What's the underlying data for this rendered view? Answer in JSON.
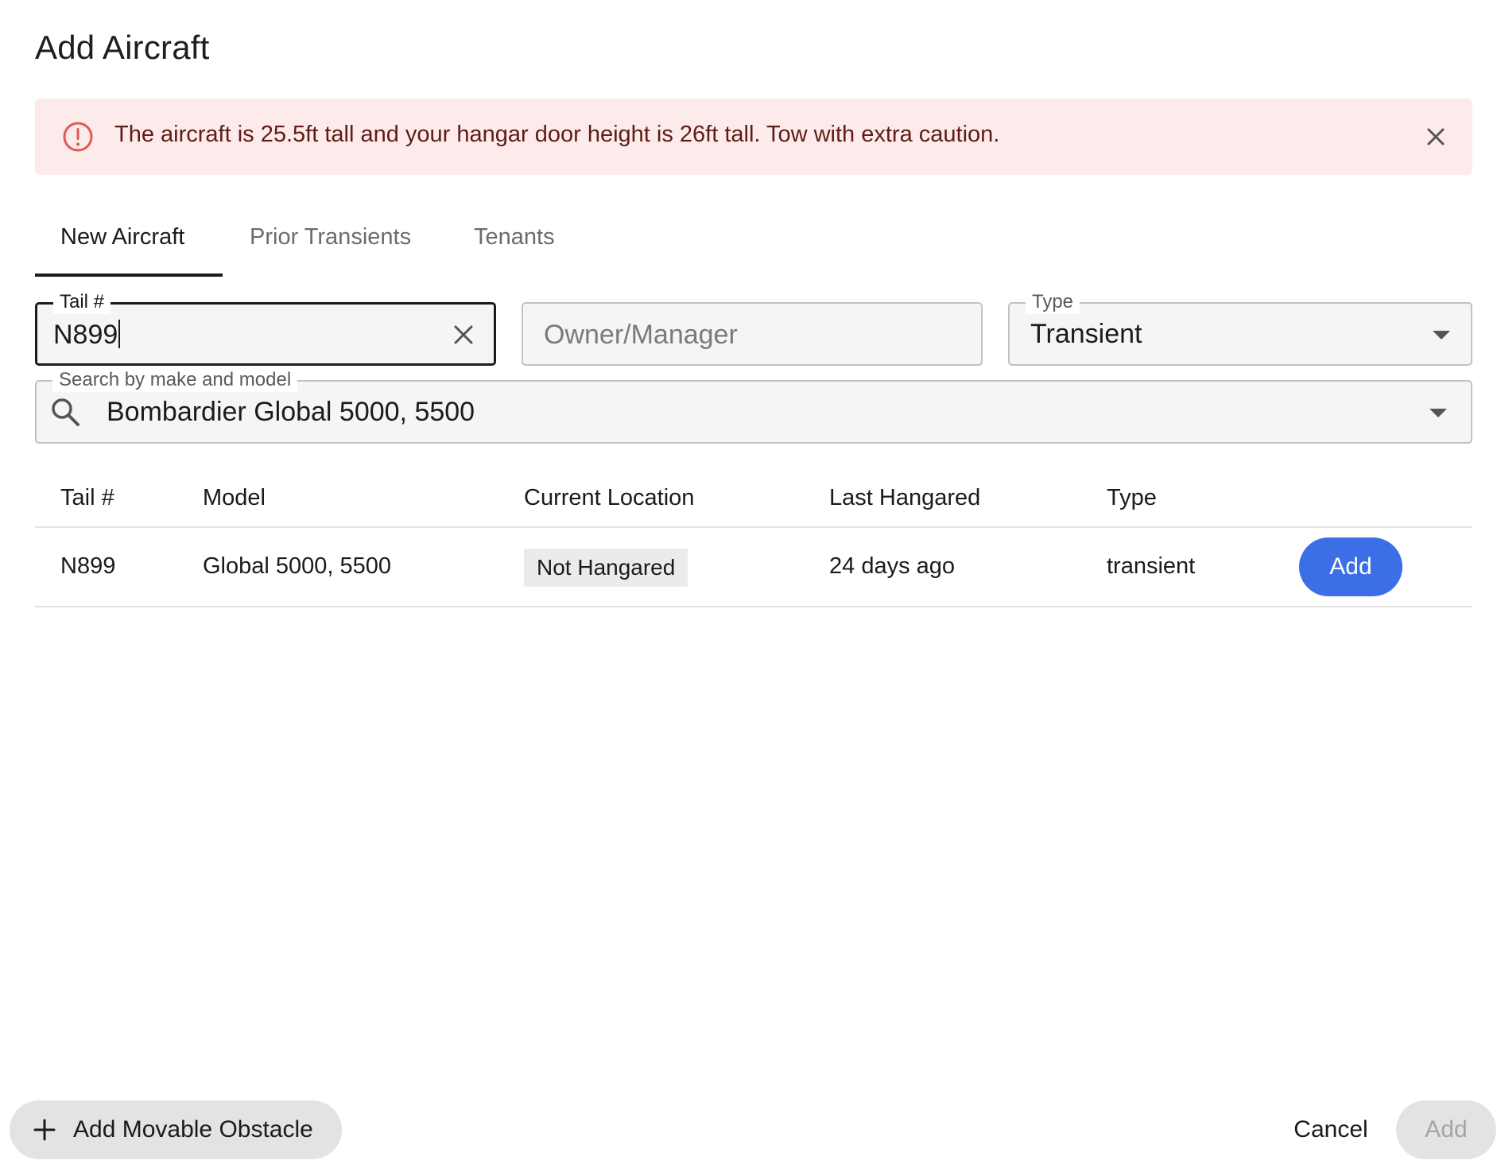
{
  "dialog": {
    "title": "Add Aircraft"
  },
  "alert": {
    "message": "The aircraft is 25.5ft tall and your hangar door height is 26ft tall. Tow with extra caution.",
    "icon": "warning-circle-icon",
    "color": "#e05a55",
    "background": "#fcebea"
  },
  "tabs": [
    {
      "label": "New Aircraft",
      "active": true
    },
    {
      "label": "Prior Transients",
      "active": false
    },
    {
      "label": "Tenants",
      "active": false
    }
  ],
  "form": {
    "tail": {
      "label": "Tail #",
      "value": "N899"
    },
    "owner": {
      "placeholder": "Owner/Manager",
      "value": ""
    },
    "type": {
      "label": "Type",
      "value": "Transient"
    },
    "model_search": {
      "label": "Search by make and model",
      "value": "Bombardier Global 5000, 5500"
    }
  },
  "table": {
    "columns": [
      "Tail #",
      "Model",
      "Current Location",
      "Last Hangared",
      "Type"
    ],
    "rows": [
      {
        "tail": "N899",
        "model": "Global 5000, 5500",
        "location": "Not Hangared",
        "last_hangared": "24 days ago",
        "type": "transient",
        "action": "Add"
      }
    ]
  },
  "footer": {
    "obstacle_label": "Add Movable Obstacle",
    "cancel_label": "Cancel",
    "add_label": "Add"
  },
  "colors": {
    "primary": "#3c6fe6",
    "disabled_bg": "#e3e3e3",
    "disabled_text": "#a5a5a5"
  }
}
